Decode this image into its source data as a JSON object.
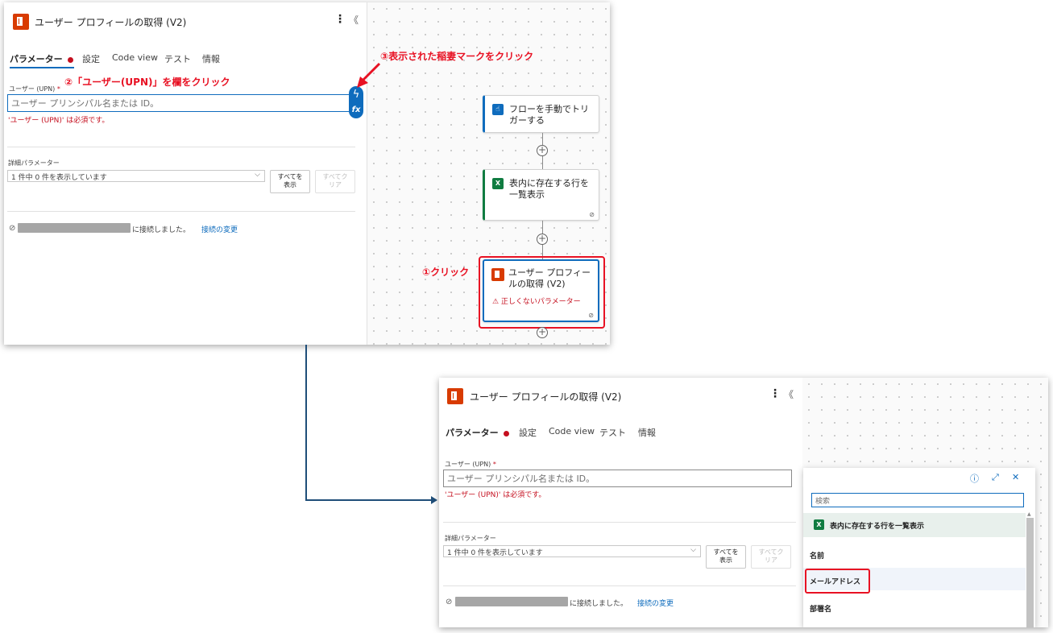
{
  "panel": {
    "title": "ユーザー プロフィールの取得 (V2)",
    "tabs": [
      "パラメーター",
      "設定",
      "Code view",
      "テスト",
      "情報"
    ],
    "upn_label": "ユーザー (UPN)",
    "required_mark": "*",
    "upn_placeholder": "ユーザー プリンシパル名または ID。",
    "upn_error": "'ユーザー (UPN)' は必須です。",
    "advanced_label": "詳細パラメーター",
    "advanced_select": "1 件中 0 件を表示しています",
    "show_all_btn": [
      "すべてを",
      "表示"
    ],
    "clear_all_btn": [
      "すべてク",
      "リア"
    ],
    "connected_text": "に接続しました。",
    "change_connection": "接続の変更",
    "more_icon": "⋮",
    "collapse_icon": "《"
  },
  "side_buttons": {
    "lightning": "ϟ",
    "fx": "fx"
  },
  "flow": {
    "trigger_label": [
      "フローを手動でトリ",
      "ガーする"
    ],
    "list_rows_label": [
      "表内に存在する行を",
      "一覧表示"
    ],
    "get_profile_label": [
      "ユーザー プロフィー",
      "ルの取得 (V2)"
    ],
    "warning": "⚠ 正しくないパラメーター"
  },
  "annotations": {
    "step1": "①クリック",
    "step2": "②「ユーザー(UPN)」を欄をクリック",
    "step3": "③表示された稲妻マークをクリック"
  },
  "popup": {
    "search_placeholder": "検索",
    "group_title": "表内に存在する行を一覧表示",
    "items": [
      "名前",
      "メールアドレス",
      "部署名"
    ],
    "icons": [
      "ⓘ",
      "⤢",
      "✕"
    ]
  },
  "colors": {
    "accent": "#0f6cbd",
    "error": "#c50f1f",
    "annotation": "#e81123",
    "excel": "#107c41",
    "office": "#d83b01"
  }
}
